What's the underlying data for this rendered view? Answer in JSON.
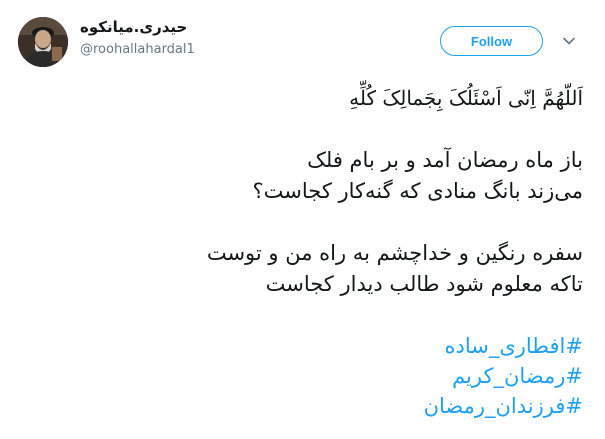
{
  "author": {
    "display_name": "حیدری.میانکوه",
    "handle": "@roohallahardal1",
    "avatar_icon": "user-avatar"
  },
  "actions": {
    "follow_label": "Follow",
    "more_icon": "chevron-down-icon"
  },
  "tweet": {
    "lines": [
      "اَللّهُمَّ اِنّی اَسْئَلُکَ بِجَمالِکَ کُلِّهِ",
      "",
      "باز ماه رمضان آمد و بر بام فلک",
      "می‌زند بانگ منادی که گنه‌کار کجاست؟",
      "",
      "سفره رنگین و خداچشم به راه من و توست",
      "تاکه معلوم شود طالب دیدار کجاست"
    ],
    "hashtags": [
      "#افطاری_ساده",
      "#رمضان_کریم",
      "#فرزندان_رمضان"
    ]
  },
  "colors": {
    "accent": "#1da1f2",
    "text": "#14171a",
    "muted": "#657786"
  }
}
